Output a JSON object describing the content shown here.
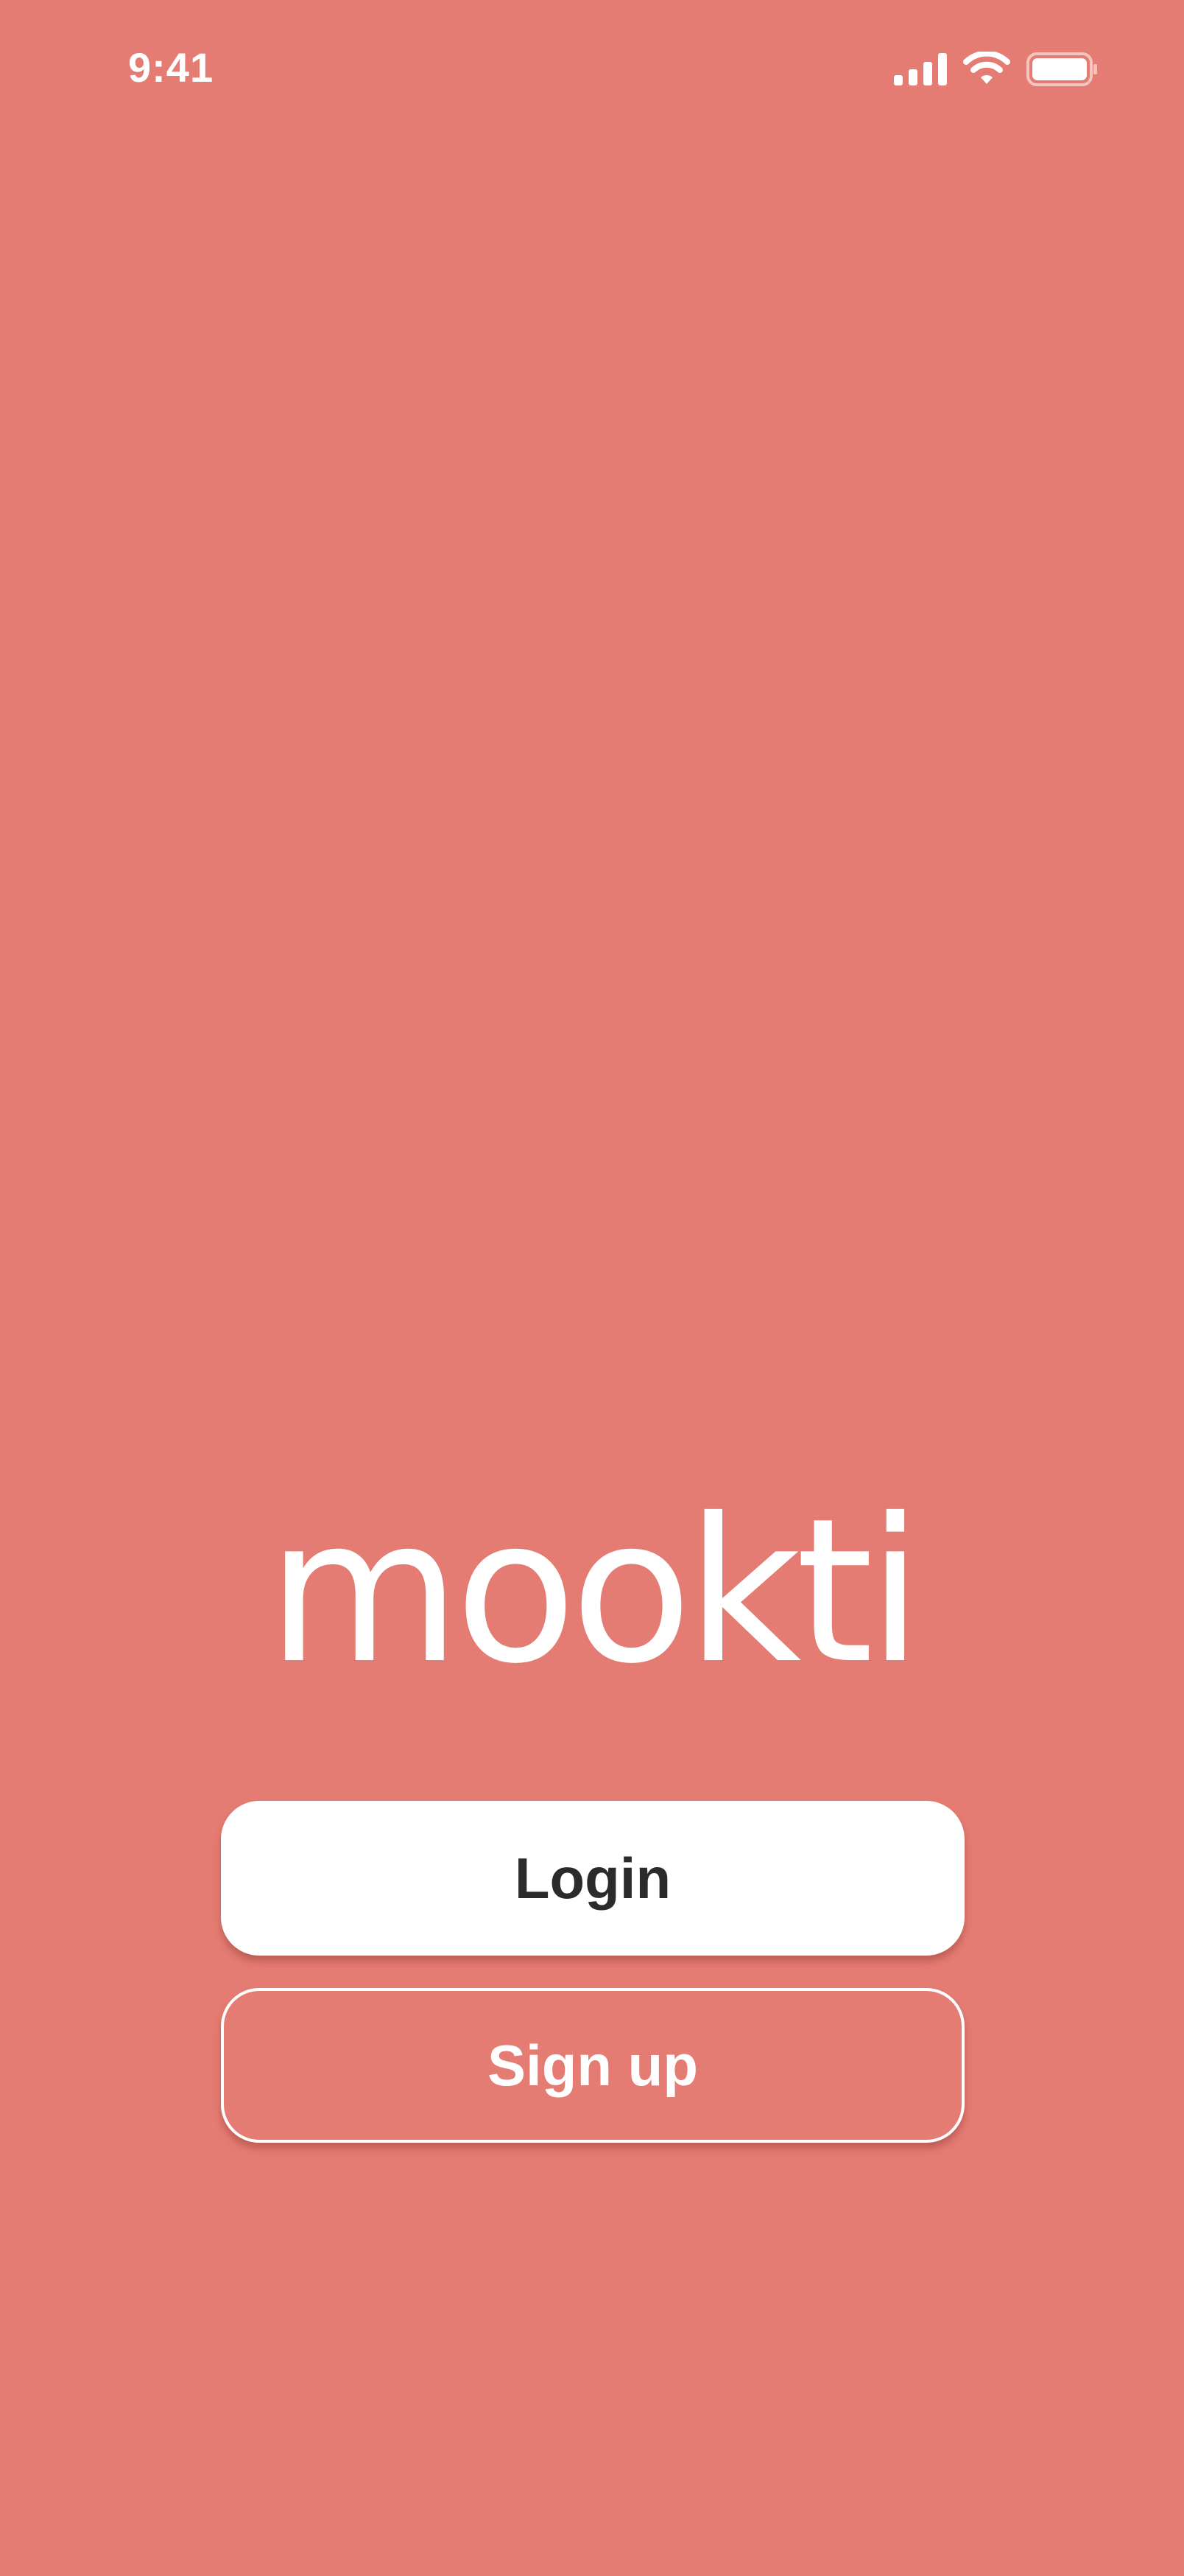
{
  "status_bar": {
    "time": "9:41",
    "icons": [
      "cellular-signal-icon",
      "wifi-icon",
      "battery-icon"
    ]
  },
  "app": {
    "logo_text": "mookti"
  },
  "actions": {
    "login_label": "Login",
    "signup_label": "Sign up"
  },
  "colors": {
    "background": "#e57c73",
    "login_button_bg": "#ffffff",
    "login_button_text": "#2b2b2b",
    "signup_border": "#ffffff",
    "text_light": "#ffffff"
  }
}
